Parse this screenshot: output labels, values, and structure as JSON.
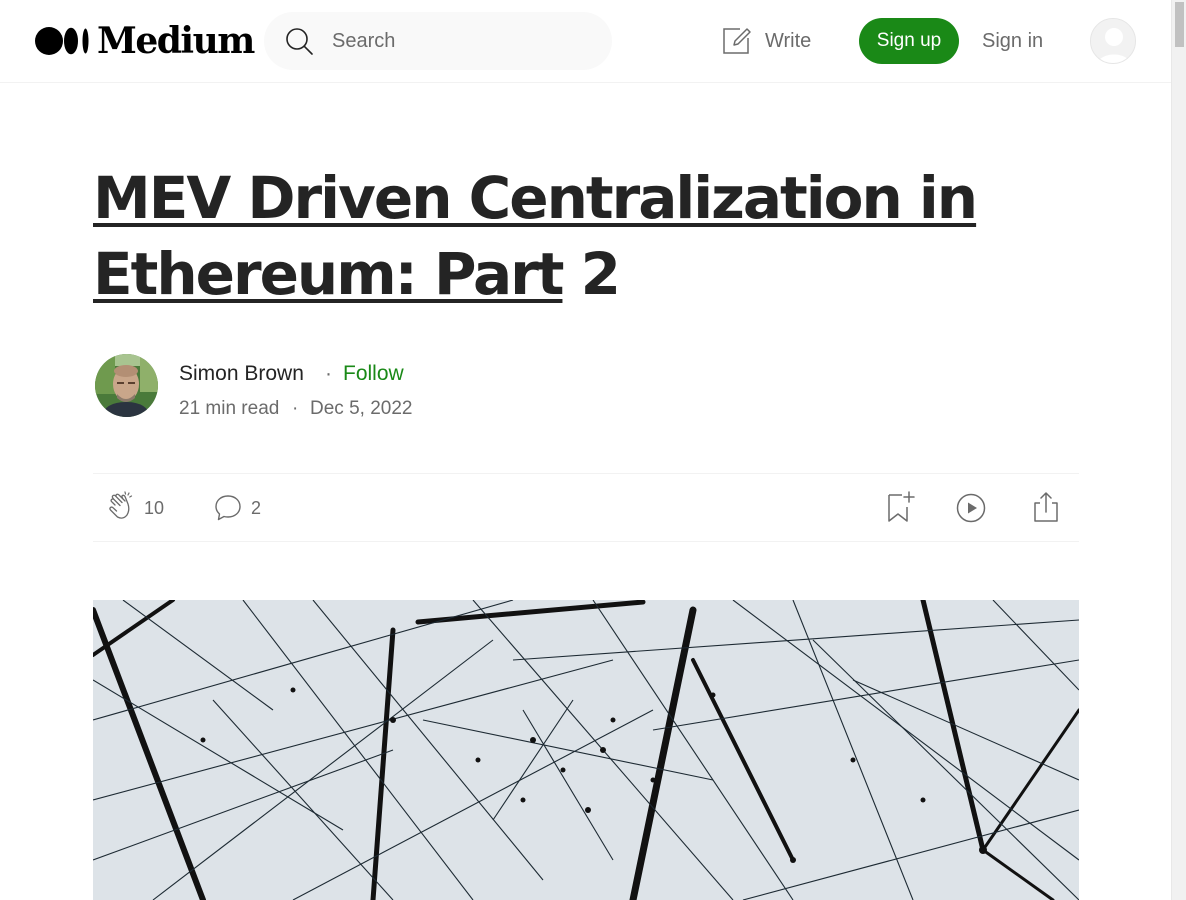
{
  "header": {
    "logo_text": "Medium",
    "search": {
      "placeholder": "Search"
    },
    "write_label": "Write",
    "signup_label": "Sign up",
    "signin_label": "Sign in"
  },
  "article": {
    "title_linked": "MEV Driven Centralization in Ethereum: Part",
    "title_rest": " 2",
    "author": {
      "name": "Simon Brown",
      "separator": "·",
      "follow_label": "Follow"
    },
    "read_time": "21 min read",
    "meta_separator": "·",
    "date": "Dec 5, 2022",
    "actions": {
      "claps": "10",
      "responses": "2"
    }
  },
  "colors": {
    "accent": "#1a8917",
    "text": "#242424",
    "muted": "#6b6b6b"
  },
  "icons": [
    "search-icon",
    "write-icon",
    "user-avatar-icon",
    "clap-icon",
    "response-icon",
    "bookmark-add-icon",
    "play-icon",
    "share-icon"
  ]
}
